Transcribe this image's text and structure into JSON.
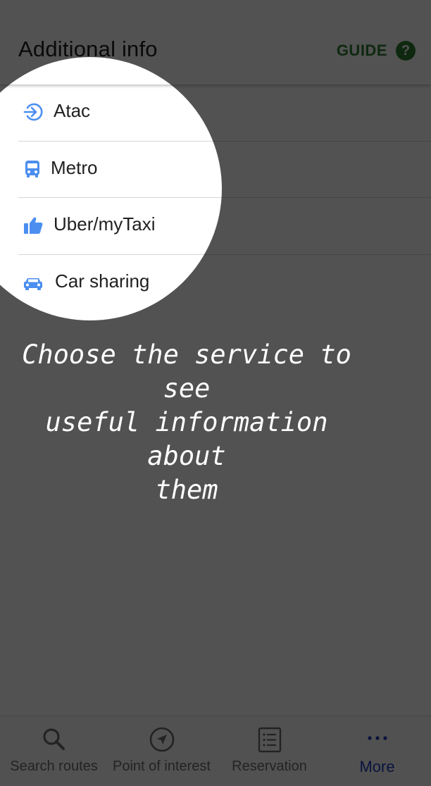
{
  "header": {
    "title": "Additional info",
    "guide_label": "GUIDE",
    "help_icon": "question-circle-icon",
    "help_glyph": "?"
  },
  "services": [
    {
      "label": "Atac",
      "icon": "arrow-login-icon"
    },
    {
      "label": "Metro",
      "icon": "bus-icon"
    },
    {
      "label": "Uber/myTaxi",
      "icon": "thumbs-up-icon"
    },
    {
      "label": "Car sharing",
      "icon": "car-icon"
    }
  ],
  "tutorial": {
    "text": "Choose the service to see\nuseful information about\nthem"
  },
  "bottom_nav": [
    {
      "label": "Search routes",
      "icon": "search-icon",
      "active": false
    },
    {
      "label": "Point of interest",
      "icon": "navigation-arrow-icon",
      "active": false
    },
    {
      "label": "Reservation",
      "icon": "list-icon",
      "active": false
    },
    {
      "label": "More",
      "icon": "more-dots-icon",
      "active": true
    }
  ],
  "colors": {
    "icon_blue": "#4b8ef0",
    "guide_green": "#2e7d32",
    "nav_active": "#1e3fbf",
    "nav_inactive": "#6f6f6f",
    "overlay": "rgba(0,0,0,0.68)"
  }
}
